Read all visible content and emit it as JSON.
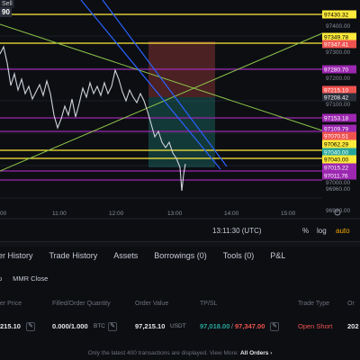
{
  "chart": {
    "badge_text": "Sell",
    "badge_value": "90",
    "x_axis_labels": [
      "00",
      "11:00",
      "12:00",
      "13:00",
      "14:00",
      "15:00"
    ],
    "time_readout": "13:11:30 (UTC)",
    "controls": {
      "percent": "%",
      "log": "log",
      "auto": "auto"
    },
    "price_scale_labels": [
      "97400.00",
      "97300.00",
      "97200.00",
      "97100.00",
      "97000.00",
      "96960.00",
      "96920.00"
    ],
    "price_tags": [
      {
        "value": "97430.32",
        "bg": "#ffeb3b",
        "fg": "#000000"
      },
      {
        "value": "97349.78",
        "bg": "#ffeb3b",
        "fg": "#000000"
      },
      {
        "value": "97347.41",
        "bg": "#ef5350",
        "fg": "#ffffff"
      },
      {
        "value": "97280.70",
        "bg": "#9c27b0",
        "fg": "#ffffff"
      },
      {
        "value": "97215.10",
        "bg": "#ef5350",
        "fg": "#ffffff"
      },
      {
        "value": "97208.42",
        "bg": "#2a2e39",
        "fg": "#ffffff"
      },
      {
        "value": "97153.18",
        "bg": "#9c27b0",
        "fg": "#ffffff"
      },
      {
        "value": "97109.79",
        "bg": "#9c27b0",
        "fg": "#ffffff"
      },
      {
        "value": "97070.51",
        "bg": "#ef5350",
        "fg": "#ffffff"
      },
      {
        "value": "97062.29",
        "bg": "#ffeb3b",
        "fg": "#000000"
      },
      {
        "value": "97040.00",
        "bg": "#26a69a",
        "fg": "#ffffff"
      },
      {
        "value": "97040.00",
        "bg": "#ffeb3b",
        "fg": "#000000"
      },
      {
        "value": "97015.22",
        "bg": "#9c27b0",
        "fg": "#ffffff"
      },
      {
        "value": "97011.76",
        "bg": "#9c27b0",
        "fg": "#ffffff"
      }
    ]
  },
  "tabs": [
    "rder History",
    "Trade History",
    "Assets",
    "Borrowings (0)",
    "Tools (0)",
    "P&L"
  ],
  "subtabs": [
    "p",
    "MMR Close"
  ],
  "table": {
    "headers": [
      "er Price",
      "Filled/Order Quantity",
      "Order Value",
      "TP/SL",
      "Trade Type",
      "Or"
    ],
    "row": {
      "price": "215.10",
      "quantity": "0.000/1.000",
      "quantity_unit": "BTC",
      "value": "97,215.10",
      "value_unit": "USDT",
      "tp": "97,018.00",
      "sl": "97,347.00",
      "trade_type": "Open Short",
      "order_time": "202"
    }
  },
  "footnote": {
    "text": "Only the latest 400 transactions are displayed. View More:",
    "link": "All Orders"
  },
  "colors": {
    "up": "#26a69a",
    "down": "#ef5350",
    "accent": "#f7a600"
  }
}
